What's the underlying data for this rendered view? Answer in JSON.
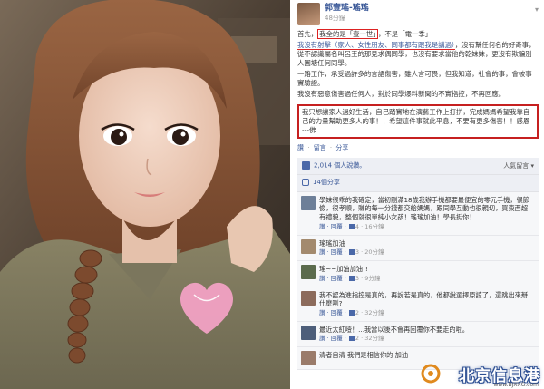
{
  "post": {
    "author": "郭壹瑤-瑤瑤",
    "time_ago": "48分鐘",
    "para1_a": "首先，",
    "para1_hl": "我全的是「壹一世」",
    "para1_b": "，不是「電一季」",
    "para2_hl": "我沒有射擊（家人、女性朋友、同事都有跟我是講過）",
    "para2_b": "，沒有幫任何名的好奇事，從不認識屬名叫呂王的那見求偶同學，也沒有要求當他的乾妹妹，更沒有欺騙別人園塘任何同學。",
    "para3": "一路工作，承受過許多的言語傷害，雖人言可畏，但我知道，社會的事，會被事實驗證。",
    "para4": "我沒有惡意傷害過任何人，對於同學爆料新聞的不實指控，不再回應。",
    "boxed": "我只想讓家人過好生活，自己踏實地在演藝工作上打拼，完成媽媽希望我靠自己的力量幫助更多人的事！！希望這件事就此平息，不要有更多傷害！！感恩 ---佛",
    "actions": [
      "讚",
      "留言",
      "分享"
    ],
    "likes": "2,014 個人說讚。",
    "sort_label": "人氣留言 ▾",
    "shares": "14個分享"
  },
  "comments": [
    {
      "name": "",
      "text": "學妹很乖的我確定，當初剛滿18歲我辦手機都要最便宜的零元手機，很節儉，很孝順，賺的每一分錢都交給媽媽，跟同學互動也很親切，買東西超有禮貌，整個就很單純小女孩！瑤瑤加油！學長挺你！",
      "actions": "讚 · 回覆 · ",
      "likes": "4",
      "time": "16分鐘"
    },
    {
      "name": "",
      "text": "瑤瑤加油",
      "actions": "讚 · 回覆 · ",
      "likes": "3",
      "time": "20分鐘"
    },
    {
      "name": "",
      "text": "瑤~~加油加油!!",
      "actions": "讚 · 回覆 · ",
      "likes": "3",
      "time": "9分鐘"
    },
    {
      "name": "",
      "text": "我不認為進指控是真的，再說若是真的，他都說選擇原諒了，還跳出來掰什麼咧?",
      "actions": "讚 · 回覆 · ",
      "likes": "2",
      "time": "32分鐘"
    },
    {
      "name": "",
      "text": "最近太紅噎！...我當以後不會再回覆你不要走的啦。",
      "actions": "讚 · 回覆 · ",
      "likes": "2",
      "time": "32分鐘"
    },
    {
      "name": "",
      "text": "清者自清 我們是相信你的 加油",
      "actions": "",
      "likes": "",
      "time": ""
    }
  ],
  "watermark": {
    "text": "北京信息港",
    "url": "www.BJXXG.com"
  },
  "colors": {
    "link": "#3b5998",
    "highlight_red": "#d22",
    "panel_bg": "#f6f7f9",
    "sticker_pink": "#f5a3c7"
  },
  "icons": {
    "heart_sticker": "heart-sticker-icon",
    "like": "like-thumb-icon",
    "share": "share-icon"
  }
}
